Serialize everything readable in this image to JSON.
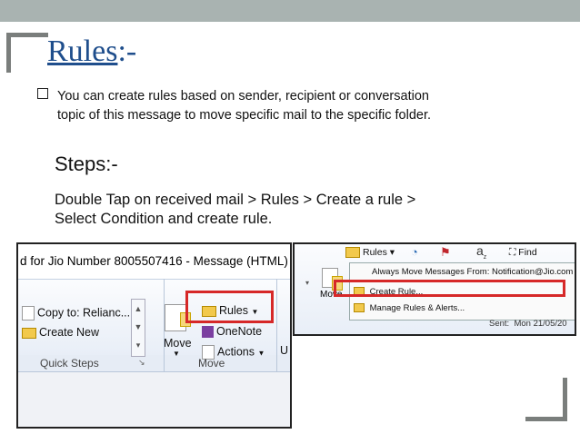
{
  "slide": {
    "title_underlined": "Rules",
    "title_suffix": ":-",
    "bullet": "You can create rules based on sender, recipient or conversation topic of this message to move specific mail to the specific folder.",
    "steps_heading": "Steps:-",
    "instruction": "Double Tap on received mail > Rules > Create a rule > Select Condition and create rule."
  },
  "screenshot_left": {
    "window_title": "d for Jio Number 8005507416 - Message (HTML)",
    "quick_steps": [
      "Copy to: Relianc...",
      "Create New"
    ],
    "move_label": "Move",
    "rules_label": "Rules",
    "onenote_label": "OneNote",
    "actions_label": "Actions",
    "group_quick_steps": "Quick Steps",
    "group_move": "Move",
    "partial_letter": "U"
  },
  "screenshot_right": {
    "rules_button": "Rules",
    "find_label": "Find",
    "move_label": "Move",
    "menu_items": [
      "Always Move Messages From: Notification@Jio.com",
      "Create Rule...",
      "Manage Rules & Alerts..."
    ],
    "sent_label": "Sent:",
    "sent_value": "Mon 21/05/20"
  },
  "colors": {
    "title": "#1f4e8c",
    "highlight": "#d62828",
    "topbar": "#a9b3b1"
  }
}
